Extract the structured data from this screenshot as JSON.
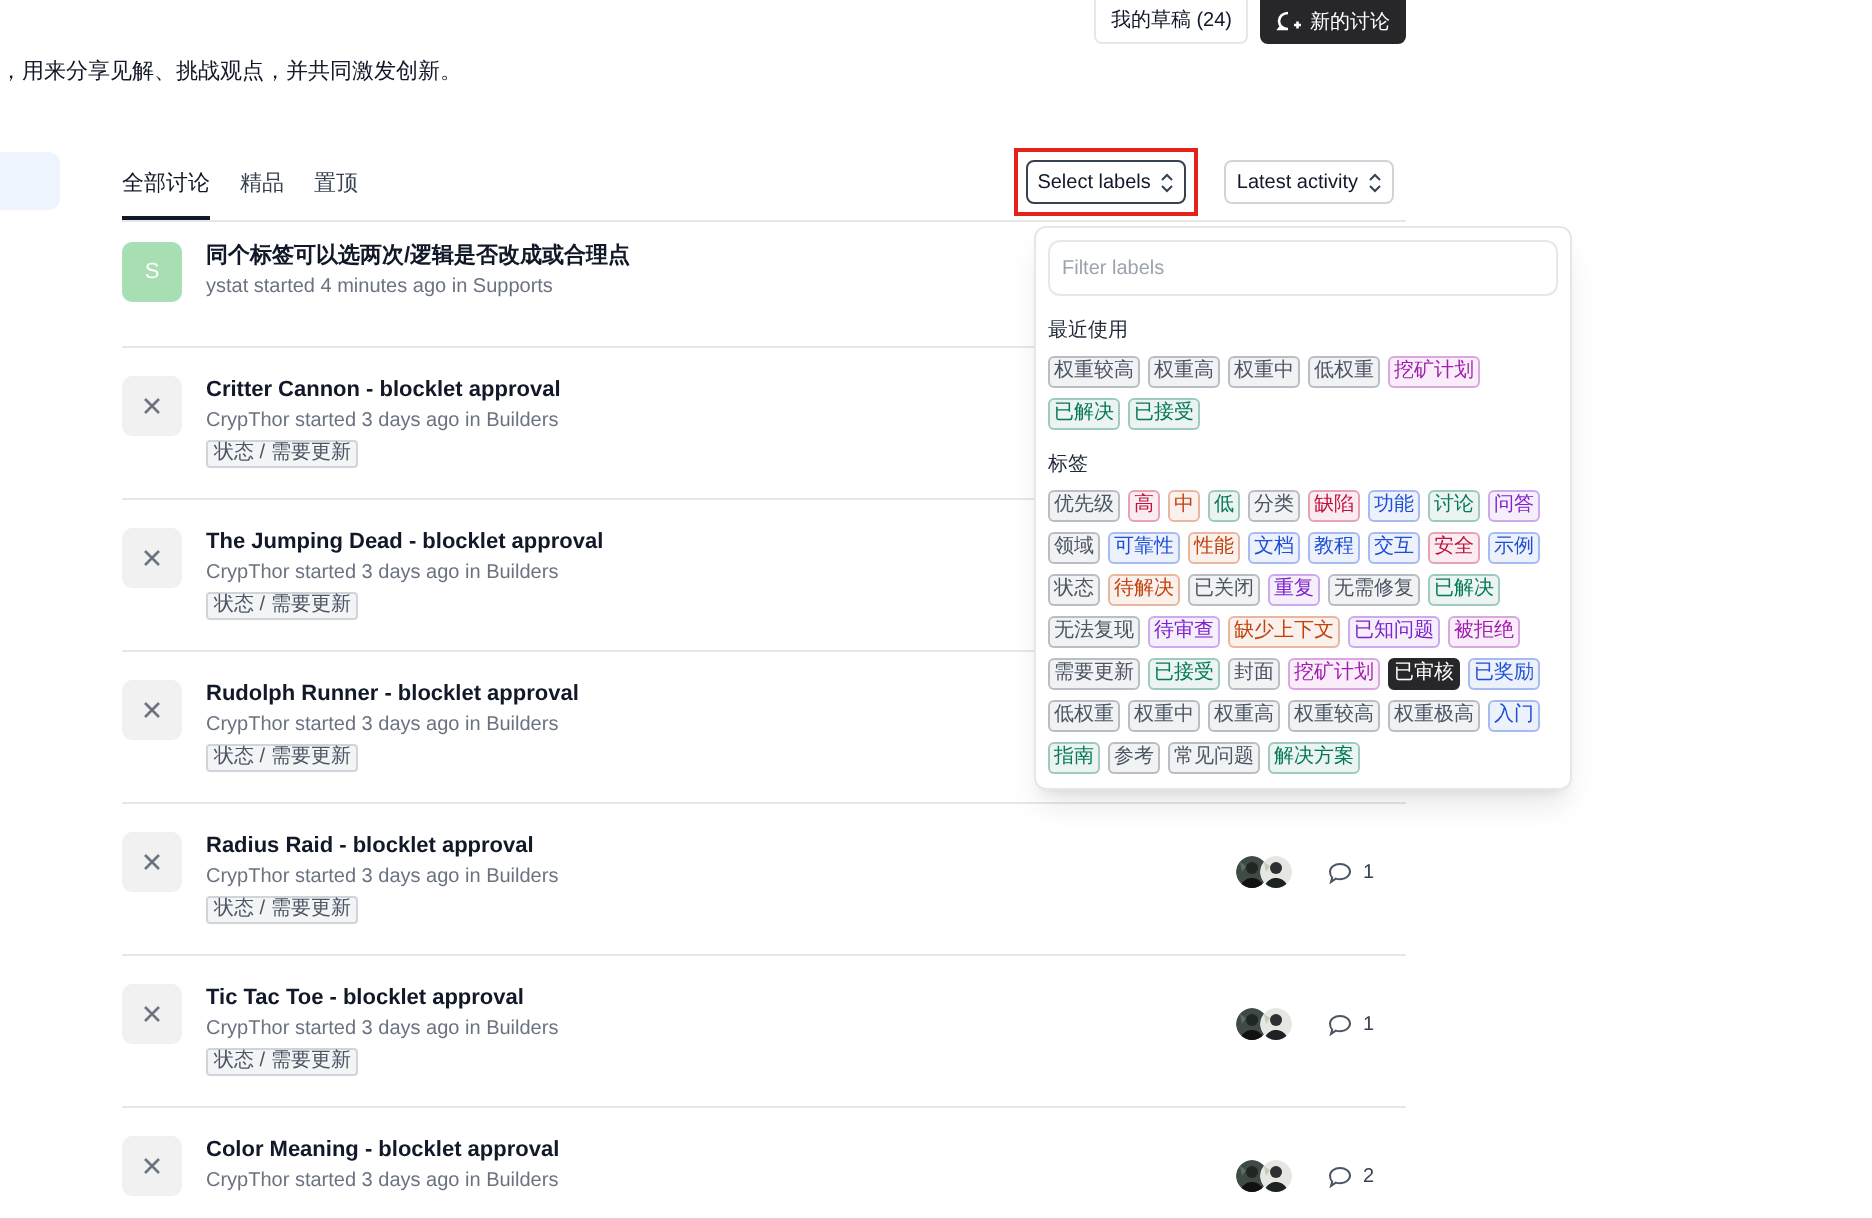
{
  "header": {
    "buttons": [
      {
        "label": "我的草稿 (24)",
        "kind": "outline"
      },
      {
        "label": "新的讨论",
        "kind": "primary"
      }
    ],
    "description": "，用来分享见解、挑战观点，并共同激发创新。"
  },
  "tabs": [
    {
      "label": "全部讨论",
      "selected": true
    },
    {
      "label": "精品",
      "selected": false
    },
    {
      "label": "置顶",
      "selected": false
    }
  ],
  "filters": [
    {
      "label": "Select labels",
      "highlighted": true
    },
    {
      "label": "Latest activity",
      "highlighted": false
    }
  ],
  "discussions": [
    {
      "title": "同个标签可以选两次/逻辑是否改成或合理点",
      "meta": "ystat started 4 minutes ago in Supports",
      "avatar_letter": "S"
    },
    {
      "title": "Critter Cannon - blocklet approval",
      "meta": "CrypThor started 3 days ago in Builders",
      "tags": [
        "状态 / 需要更新"
      ]
    },
    {
      "title": "The Jumping Dead - blocklet approval",
      "meta": "CrypThor started 3 days ago in Builders",
      "tags": [
        "状态 / 需要更新"
      ]
    },
    {
      "title": "Rudolph Runner - blocklet approval",
      "meta": "CrypThor started 3 days ago in Builders",
      "tags": [
        "状态 / 需要更新"
      ]
    },
    {
      "title": "Radius Raid - blocklet approval",
      "meta": "CrypThor started 3 days ago in Builders",
      "tags": [
        "状态 / 需要更新"
      ],
      "comments": "1"
    },
    {
      "title": "Tic Tac Toe - blocklet approval",
      "meta": "CrypThor started 3 days ago in Builders",
      "tags": [
        "状态 / 需要更新"
      ],
      "comments": "1"
    },
    {
      "title": "Color Meaning - blocklet approval",
      "meta": "CrypThor started 3 days ago in Builders",
      "comments": "2"
    }
  ],
  "label_popup": {
    "placeholder": "Filter labels",
    "sections": [
      {
        "heading": "最近使用",
        "labels": [
          {
            "text": "权重较高",
            "color": "#4b5563",
            "selected": false
          },
          {
            "text": "权重高",
            "color": "#4b5563",
            "selected": false
          },
          {
            "text": "权重中",
            "color": "#4b5563",
            "selected": false
          },
          {
            "text": "低权重",
            "color": "#4b5563",
            "selected": false
          },
          {
            "text": "挖矿计划",
            "color": "#a21caf",
            "selected": false
          },
          {
            "text": "已解决",
            "color": "#047857",
            "selected": false
          },
          {
            "text": "已接受",
            "color": "#047857",
            "selected": false
          }
        ]
      },
      {
        "heading": "标签",
        "labels": [
          {
            "text": "优先级",
            "color": "#4b5563",
            "selected": false
          },
          {
            "text": "高",
            "color": "#be123c",
            "selected": false
          },
          {
            "text": "中",
            "color": "#c2410c",
            "selected": false
          },
          {
            "text": "低",
            "color": "#047857",
            "selected": false
          },
          {
            "text": "分类",
            "color": "#4b5563",
            "selected": false
          },
          {
            "text": "缺陷",
            "color": "#be123c",
            "selected": false
          },
          {
            "text": "功能",
            "color": "#1d4ed8",
            "selected": false
          },
          {
            "text": "讨论",
            "color": "#047857",
            "selected": false
          },
          {
            "text": "问答",
            "color": "#7e22ce",
            "selected": false
          },
          {
            "text": "领域",
            "color": "#4b5563",
            "selected": false
          },
          {
            "text": "可靠性",
            "color": "#1d4ed8",
            "selected": false
          },
          {
            "text": "性能",
            "color": "#c2410c",
            "selected": false
          },
          {
            "text": "文档",
            "color": "#1d4ed8",
            "selected": false
          },
          {
            "text": "教程",
            "color": "#1d4ed8",
            "selected": false
          },
          {
            "text": "交互",
            "color": "#1d4ed8",
            "selected": false
          },
          {
            "text": "安全",
            "color": "#be123c",
            "selected": false
          },
          {
            "text": "示例",
            "color": "#1d4ed8",
            "selected": false
          },
          {
            "text": "状态",
            "color": "#4b5563",
            "selected": false
          },
          {
            "text": "待解决",
            "color": "#c2410c",
            "selected": false
          },
          {
            "text": "已关闭",
            "color": "#4b5563",
            "selected": false
          },
          {
            "text": "重复",
            "color": "#7e22ce",
            "selected": false
          },
          {
            "text": "无需修复",
            "color": "#4b5563",
            "selected": false
          },
          {
            "text": "已解决",
            "color": "#047857",
            "selected": false
          },
          {
            "text": "无法复现",
            "color": "#4b5563",
            "selected": false
          },
          {
            "text": "待审查",
            "color": "#7e22ce",
            "selected": false
          },
          {
            "text": "缺少上下文",
            "color": "#c2410c",
            "selected": false
          },
          {
            "text": "已知问题",
            "color": "#7e22ce",
            "selected": false
          },
          {
            "text": "被拒绝",
            "color": "#a21caf",
            "selected": false
          },
          {
            "text": "需要更新",
            "color": "#4b5563",
            "selected": false
          },
          {
            "text": "已接受",
            "color": "#047857",
            "selected": false
          },
          {
            "text": "封面",
            "color": "#4b5563",
            "selected": false
          },
          {
            "text": "挖矿计划",
            "color": "#a21caf",
            "selected": false
          },
          {
            "text": "已审核",
            "color": "#27272a",
            "selected": true
          },
          {
            "text": "已奖励",
            "color": "#1d4ed8",
            "selected": false
          },
          {
            "text": "低权重",
            "color": "#4b5563",
            "selected": false
          },
          {
            "text": "权重中",
            "color": "#4b5563",
            "selected": false
          },
          {
            "text": "权重高",
            "color": "#4b5563",
            "selected": false
          },
          {
            "text": "权重较高",
            "color": "#4b5563",
            "selected": false
          },
          {
            "text": "权重极高",
            "color": "#4b5563",
            "selected": false
          },
          {
            "text": "入门",
            "color": "#1d4ed8",
            "selected": false
          },
          {
            "text": "指南",
            "color": "#047857",
            "selected": false
          },
          {
            "text": "参考",
            "color": "#4b5563",
            "selected": false
          },
          {
            "text": "常见问题",
            "color": "#4b5563",
            "selected": false
          },
          {
            "text": "解决方案",
            "color": "#047857",
            "selected": false
          }
        ]
      }
    ]
  }
}
